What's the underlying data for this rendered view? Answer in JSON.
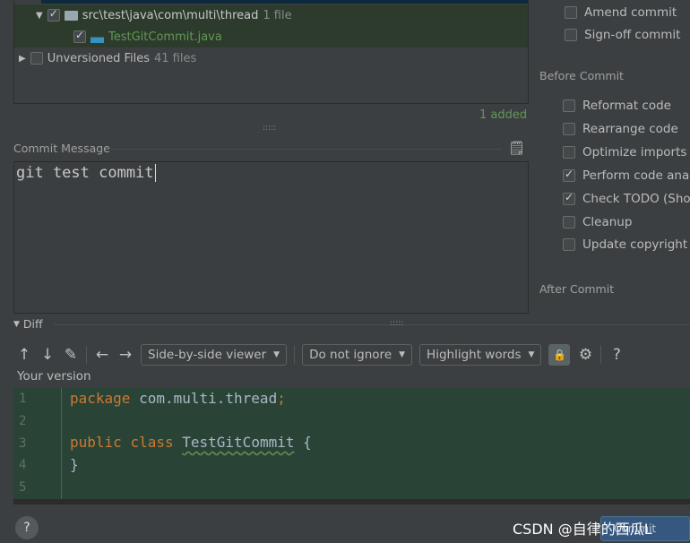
{
  "tree": {
    "folder": {
      "label": "src\\test\\java\\com\\multi\\thread",
      "count": "1 file",
      "checked": true
    },
    "file": {
      "label": "TestGitCommit.java",
      "checked": true
    },
    "unversioned": {
      "label": "Unversioned Files",
      "count": "41 files",
      "checked": false
    }
  },
  "status": "1 added",
  "commit_message": {
    "label": "Commit Message",
    "value": "git test commit"
  },
  "git_options": [
    {
      "label": "Amend commit",
      "checked": false
    },
    {
      "label": "Sign-off commit",
      "checked": false
    }
  ],
  "before_commit": {
    "title": "Before Commit",
    "items": [
      {
        "label": "Reformat code",
        "checked": false
      },
      {
        "label": "Rearrange code",
        "checked": false
      },
      {
        "label": "Optimize imports",
        "checked": false
      },
      {
        "label": "Perform code analysis",
        "checked": true
      },
      {
        "label": "Check TODO (Show All)",
        "checked": true
      },
      {
        "label": "Cleanup",
        "checked": false
      },
      {
        "label": "Update copyright",
        "checked": false
      }
    ]
  },
  "after_commit": {
    "title": "After Commit"
  },
  "diff": {
    "title": "Diff",
    "viewer": "Side-by-side viewer",
    "ignore": "Do not ignore",
    "highlight": "Highlight words",
    "help": "?",
    "version_label": "Your version",
    "lines": [
      "1",
      "2",
      "3",
      "4",
      "5"
    ],
    "code": {
      "l1_kw": "package",
      "l1_rest": " com.multi.thread",
      "l1_semi": ";",
      "l3_kw1": "public",
      "l3_kw2": "class",
      "l3_type": "TestGitCommit",
      "l3_brace": " {",
      "l4": "}"
    }
  },
  "footer": {
    "help": "?",
    "commit_button": "Commit",
    "watermark": "CSDN @自律的西瓜L"
  },
  "colors": {
    "added": "#629755",
    "keyword": "#cc7832",
    "diff_bg": "#294436"
  }
}
